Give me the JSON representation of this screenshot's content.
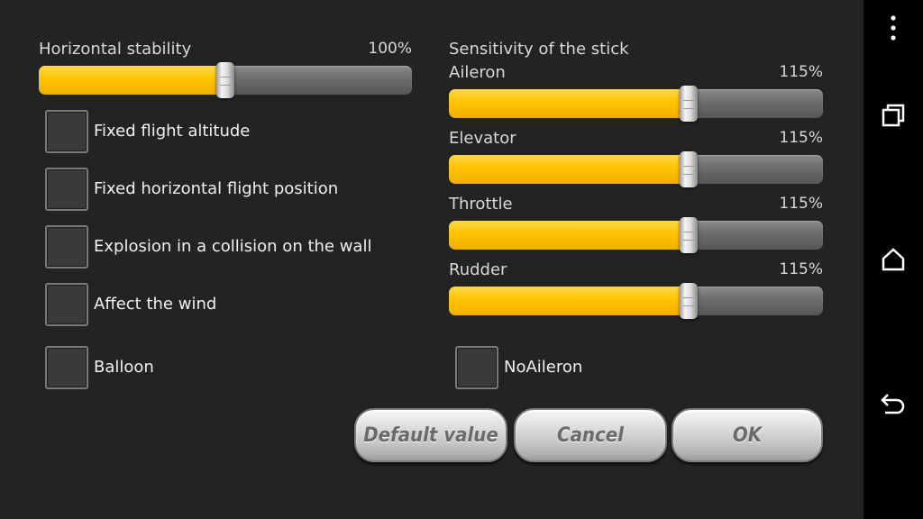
{
  "left": {
    "stability_label": "Horizontal stability",
    "stability_value": "100%",
    "stability_fraction": 0.5,
    "checkboxes": [
      {
        "label": "Fixed flight altitude"
      },
      {
        "label": "Fixed horizontal flight position"
      },
      {
        "label": "Explosion in a collision on the wall"
      },
      {
        "label": "Affect the wind"
      },
      {
        "label": "Balloon"
      }
    ]
  },
  "right": {
    "section_label": "Sensitivity of the stick",
    "sliders": [
      {
        "label": "Aileron",
        "value": "115%",
        "fraction": 0.64
      },
      {
        "label": "Elevator",
        "value": "115%",
        "fraction": 0.64
      },
      {
        "label": "Throttle",
        "value": "115%",
        "fraction": 0.64
      },
      {
        "label": "Rudder",
        "value": "115%",
        "fraction": 0.64
      }
    ],
    "noaileron_label": "NoAileron"
  },
  "buttons": {
    "default": "Default value",
    "cancel": "Cancel",
    "ok": "OK"
  },
  "nav": {
    "icons": [
      "more-vert-icon",
      "recent-apps-icon",
      "home-icon",
      "back-icon"
    ]
  },
  "colors": {
    "fill": "#ffc400",
    "background": "#232323"
  }
}
